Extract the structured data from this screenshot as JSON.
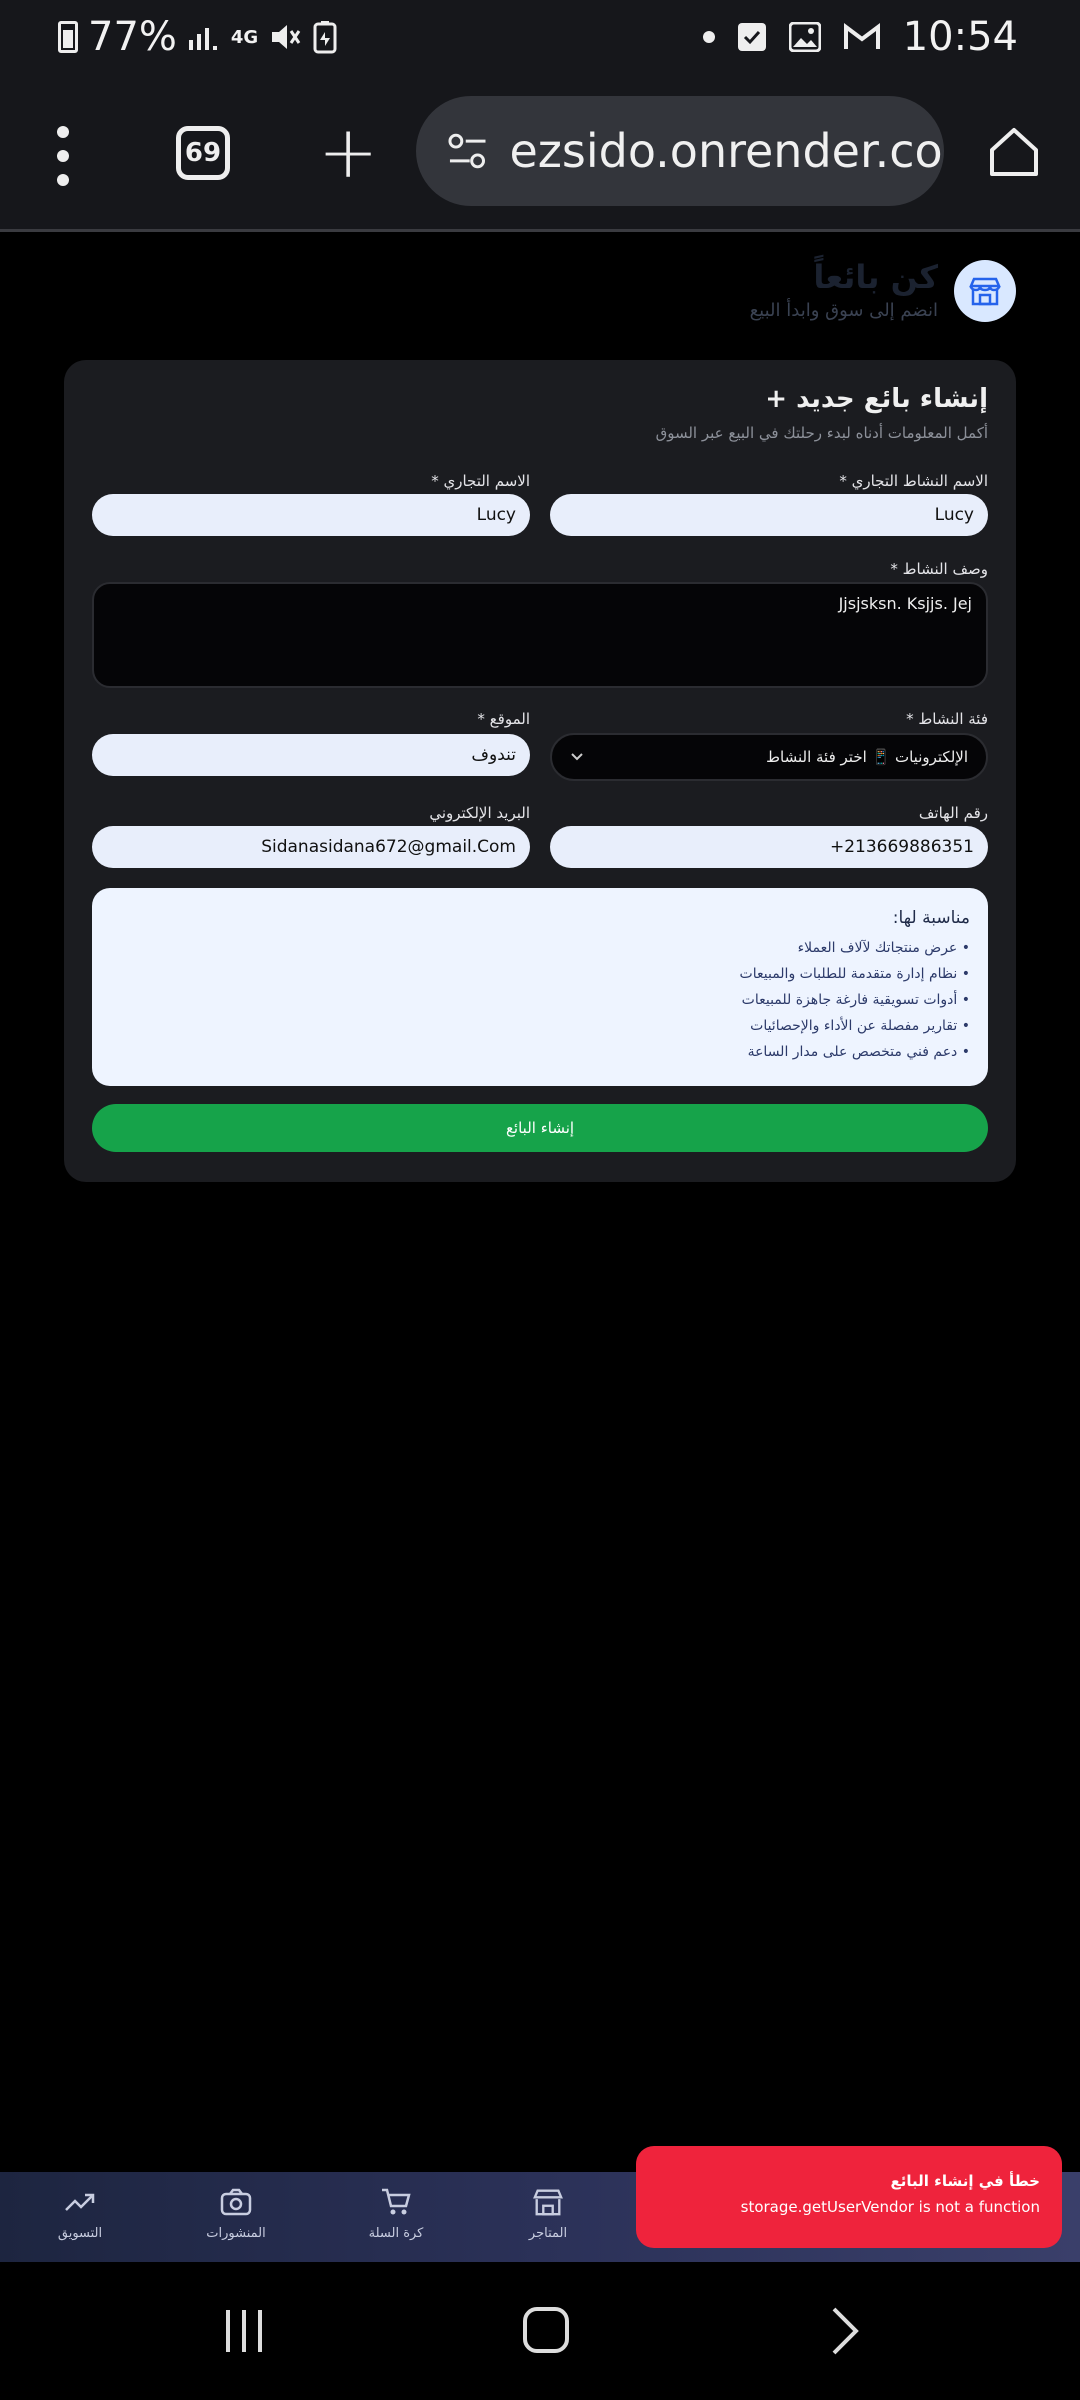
{
  "status_bar": {
    "battery": "77%",
    "network": "4G",
    "time": "10:54",
    "icons": [
      "battery-icon",
      "signal-icon",
      "4g-icon",
      "mute-icon",
      "battery-saver-icon",
      "dot-icon",
      "check-icon",
      "image-icon",
      "gmail-icon"
    ]
  },
  "browser": {
    "tab_count": "69",
    "url": "ezsido.onrender.com"
  },
  "page": {
    "title": "كن بائعاً",
    "subtitle": "انضم إلى سوق وابدأ البيع"
  },
  "form": {
    "title": "إنشاء بائع جديد",
    "subtitle": "أكمل المعلومات أدناه لبدء رحلتك في البيع عبر السوق",
    "business_name_label": "الاسم النشاط التجاري *",
    "business_name_value": "Lucy",
    "trade_name_label": "الاسم التجاري *",
    "trade_name_value": "Lucy",
    "description_label": "وصف النشاط *",
    "description_value": "Jjsjsksn. Ksjjs. Jej",
    "category_label": "فئة النشاط *",
    "category_value": "الإلكترونيات 📱 اختر فئة النشاط",
    "location_label": "الموقع *",
    "location_value": "تندوف",
    "phone_label": "رقم الهاتف",
    "phone_value": "+213669886351",
    "email_label": "البريد الإلكتروني",
    "email_value": "Sidanasidana672@gmail.Com",
    "features_title": "مناسبة لها:",
    "features": [
      "• عرض منتجاتك لآلاف العملاء",
      "• نظام إدارة متقدمة للطلبات والمبيعات",
      "• أدوات تسويقية فارغة جاهزة للمبيعات",
      "• تقارير مفصلة عن الأداء والإحصائيات",
      "• دعم فني متخصص على مدار الساعة"
    ],
    "submit_label": "إنشاء البائع"
  },
  "bottom_nav": {
    "items": [
      {
        "label": "المتاجر",
        "icon": "store-icon"
      },
      {
        "label": "كرة السلة",
        "icon": "cart-icon"
      },
      {
        "label": "المنشورات",
        "icon": "camera-icon"
      },
      {
        "label": "التسويق",
        "icon": "trending-icon"
      }
    ]
  },
  "toast": {
    "title": "خطأ في إنشاء البائع",
    "message": "storage.getUserVendor is not a function",
    "color": "#ef233c"
  },
  "colors": {
    "accent_green": "#16a34a",
    "background": "#000000",
    "card": "#1b1c20"
  }
}
